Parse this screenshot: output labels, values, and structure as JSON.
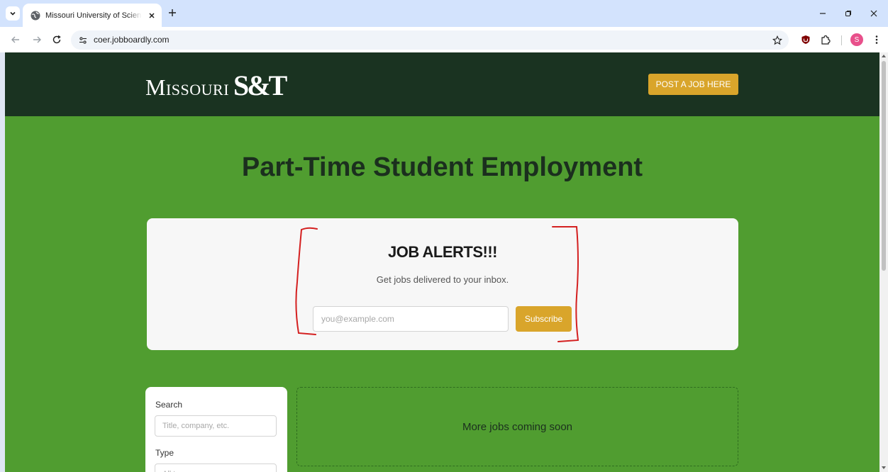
{
  "browser": {
    "tab_title": "Missouri University of Science & Technology",
    "url": "coer.jobboardly.com",
    "profile_initial": "S"
  },
  "site": {
    "logo_word": "Missouri",
    "logo_mark": "S&T",
    "post_job_label": "POST A JOB HERE",
    "page_title": "Part-Time Student Employment"
  },
  "alerts": {
    "title": "JOB ALERTS!!!",
    "subtitle": "Get jobs delivered to your inbox.",
    "email_placeholder": "you@example.com",
    "subscribe_label": "Subscribe"
  },
  "filters": {
    "search_label": "Search",
    "search_placeholder": "Title, company, etc.",
    "type_label": "Type",
    "type_placeholder": "All types"
  },
  "jobs": {
    "empty_message": "More jobs coming soon"
  },
  "colors": {
    "header_bg": "#1a3321",
    "page_bg": "#509d30",
    "accent": "#d9a52b",
    "annotation": "#d42020"
  }
}
